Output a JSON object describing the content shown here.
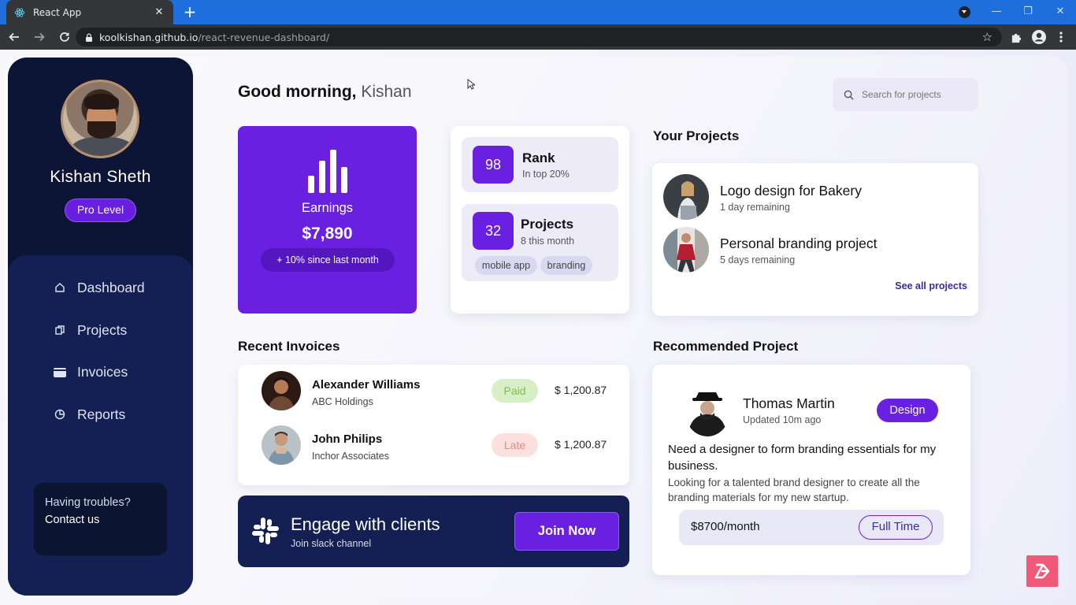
{
  "browser": {
    "tab_title": "React App",
    "url_host": "koolkishan.github.io",
    "url_path": "/react-revenue-dashboard/"
  },
  "sidebar": {
    "user_name": "Kishan Sheth",
    "level": "Pro Level",
    "items": [
      {
        "label": "Dashboard",
        "icon": "home-icon"
      },
      {
        "label": "Projects",
        "icon": "copy-icon"
      },
      {
        "label": "Invoices",
        "icon": "wallet-icon"
      },
      {
        "label": "Reports",
        "icon": "pie-chart-icon"
      }
    ],
    "help": {
      "question": "Having troubles?",
      "link": "Contact us"
    }
  },
  "header": {
    "greeting": "Good morning,",
    "name": "Kishan",
    "search_placeholder": "Search for projects"
  },
  "earnings": {
    "label": "Earnings",
    "value": "$7,890",
    "delta": "+ 10% since last month"
  },
  "stats": {
    "rank": {
      "value": "98",
      "title": "Rank",
      "sub": "In top 20%"
    },
    "projects": {
      "value": "32",
      "title": "Projects",
      "sub": "8 this month",
      "tags": [
        "mobile app",
        "branding"
      ]
    }
  },
  "your_projects": {
    "title": "Your Projects",
    "items": [
      {
        "name": "Logo design for Bakery",
        "sub": "1 day remaining"
      },
      {
        "name": "Personal branding project",
        "sub": "5 days remaining"
      }
    ],
    "see_all": "See all projects"
  },
  "invoices": {
    "title": "Recent Invoices",
    "rows": [
      {
        "name": "Alexander Williams",
        "company": "ABC Holdings",
        "status": "Paid",
        "amount": "$ 1,200.87"
      },
      {
        "name": "John Philips",
        "company": "Inchor Associates",
        "status": "Late",
        "amount": "$ 1,200.87"
      }
    ]
  },
  "slack": {
    "title": "Engage with clients",
    "sub": "Join slack channel",
    "button": "Join Now"
  },
  "recommended": {
    "title": "Recommended Project",
    "name": "Thomas Martin",
    "updated": "Updated 10m ago",
    "tag": "Design",
    "headline": "Need a designer to form branding essentials for my business.",
    "description": "Looking for a talented brand designer to create all the branding materials for my new startup.",
    "salary": "$8700/month",
    "type": "Full Time"
  },
  "colors": {
    "accent": "#6a20e0",
    "navy": "#142054",
    "sidebar_dark": "#0c1535",
    "paid": "#7cbf4f",
    "late": "#ee8a80"
  }
}
